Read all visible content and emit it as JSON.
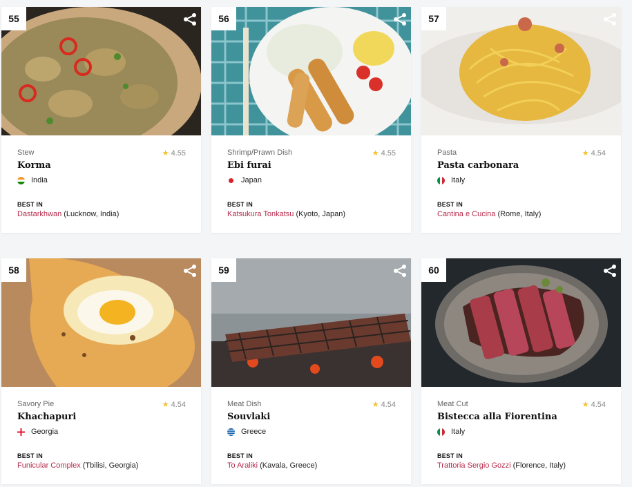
{
  "cards": [
    {
      "rank": "55",
      "category": "Stew",
      "rating": "4.55",
      "name": "Korma",
      "country": "India",
      "best_in_label": "BEST IN",
      "place_name": "Dastarkhwan",
      "place_loc": " (Lucknow, India)"
    },
    {
      "rank": "56",
      "category": "Shrimp/Prawn Dish",
      "rating": "4.55",
      "name": "Ebi furai",
      "country": "Japan",
      "best_in_label": "BEST IN",
      "place_name": "Katsukura Tonkatsu",
      "place_loc": " (Kyoto, Japan)"
    },
    {
      "rank": "57",
      "category": "Pasta",
      "rating": "4.54",
      "name": "Pasta carbonara",
      "country": "Italy",
      "best_in_label": "BEST IN",
      "place_name": "Cantina e Cucina",
      "place_loc": " (Rome, Italy)"
    },
    {
      "rank": "58",
      "category": "Savory Pie",
      "rating": "4.54",
      "name": "Khachapuri",
      "country": "Georgia",
      "best_in_label": "BEST IN",
      "place_name": "Funicular Complex",
      "place_loc": " (Tbilisi, Georgia)"
    },
    {
      "rank": "59",
      "category": "Meat Dish",
      "rating": "4.54",
      "name": "Souvlaki",
      "country": "Greece",
      "best_in_label": "BEST IN",
      "place_name": "To Araliki",
      "place_loc": " (Kavala, Greece)"
    },
    {
      "rank": "60",
      "category": "Meat Cut",
      "rating": "4.54",
      "name": "Bistecca alla Fiorentina",
      "country": "Italy",
      "best_in_label": "BEST IN",
      "place_name": "Trattoria Sergio Gozzi",
      "place_loc": " (Florence, Italy)"
    }
  ],
  "colors": {
    "link": "#b52a4a",
    "star": "#f2c230"
  },
  "icons": {
    "share": "share-icon",
    "rating": "star-icon"
  }
}
